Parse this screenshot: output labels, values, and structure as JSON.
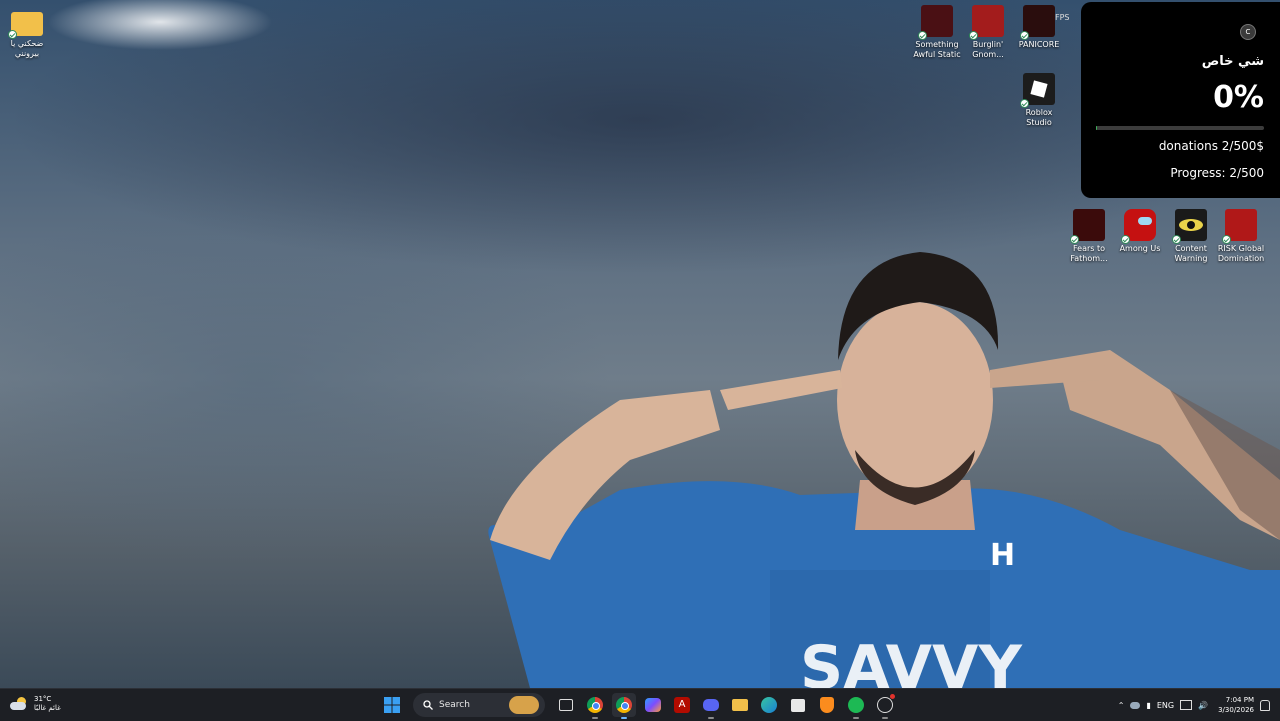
{
  "desktop": {
    "left_icons": [
      {
        "label": "ضحكني يا بيرونني",
        "icon": "folder-icon"
      }
    ],
    "top_row": [
      {
        "label": "Something Awful Static",
        "icon": "game-icon",
        "color": "#4a1014"
      },
      {
        "label": "Burglin' Gnom...",
        "icon": "game-icon",
        "color": "#a31c1c"
      },
      {
        "label": "PANICORE",
        "icon": "game-icon",
        "color": "#2a0d0d"
      }
    ],
    "second_row": [
      {
        "label": "Roblox Studio",
        "icon": "roblox-icon",
        "color": "#1c1c1c"
      }
    ],
    "third_row": [
      {
        "label": "Fears to Fathom...",
        "icon": "game-icon",
        "color": "#3b0b0b"
      },
      {
        "label": "Among Us",
        "icon": "among-us-icon",
        "color": "#c51111"
      },
      {
        "label": "Content Warning",
        "icon": "eye-icon",
        "color": "#1a1a1a"
      },
      {
        "label": "RISK Global Domination",
        "icon": "game-icon",
        "color": "#b01818"
      }
    ]
  },
  "overlay": {
    "title": "شي خاص",
    "percent": "0%",
    "progress_fraction": 0.004,
    "donations": "donations 2/500$",
    "progress": "Progress: 2/500",
    "avatar_letter": "C",
    "fps_label": "FPS"
  },
  "taskbar": {
    "weather_temp": "31°C",
    "weather_desc": "غائم غالبًا",
    "search_placeholder": "Search",
    "apps": [
      "file-explorer-icon",
      "chrome-icon",
      "chrome-icon",
      "copilot-icon",
      "acrobat-icon",
      "discord-icon",
      "folder-icon",
      "edge-icon",
      "store-icon",
      "brave-icon",
      "spotify-icon",
      "steam-icon"
    ],
    "language": "ENG",
    "time": "7:04 PM",
    "date": "3/30/2026"
  }
}
